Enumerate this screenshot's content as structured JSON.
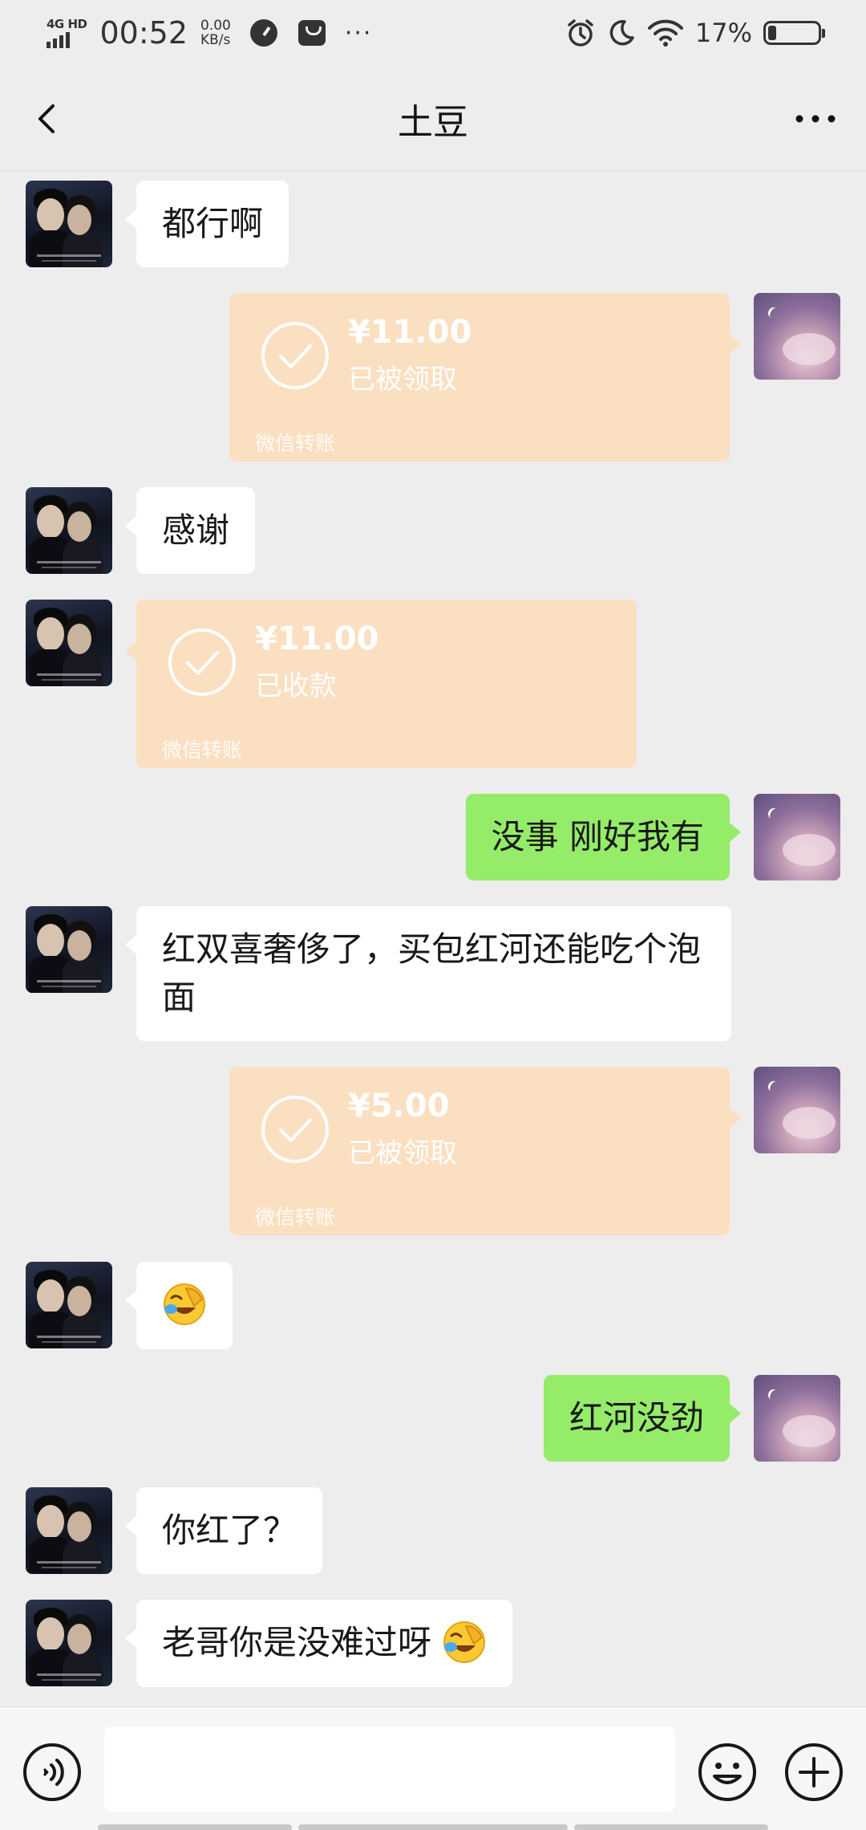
{
  "status_bar": {
    "network": "4G HD",
    "time": "00:52",
    "speed_value": "0.00",
    "speed_unit": "KB/s",
    "overflow": "···",
    "battery_percent": "17%"
  },
  "header": {
    "title": "土豆",
    "back_icon": "chevron-left-icon",
    "more_icon": "more-dots-icon"
  },
  "messages": [
    {
      "sender": "other",
      "type": "text",
      "text": "都行啊"
    },
    {
      "sender": "me",
      "type": "transfer",
      "amount": "¥11.00",
      "status": "已被领取",
      "label": "微信转账"
    },
    {
      "sender": "other",
      "type": "text",
      "text": "感谢"
    },
    {
      "sender": "other",
      "type": "transfer",
      "amount": "¥11.00",
      "status": "已收款",
      "label": "微信转账"
    },
    {
      "sender": "me",
      "type": "text",
      "text": "没事 刚好我有"
    },
    {
      "sender": "other",
      "type": "text",
      "text": "红双喜奢侈了，买包红河还能吃个泡面"
    },
    {
      "sender": "me",
      "type": "transfer",
      "amount": "¥5.00",
      "status": "已被领取",
      "label": "微信转账"
    },
    {
      "sender": "other",
      "type": "emoji",
      "emoji": "facepalm-laughing-emoji"
    },
    {
      "sender": "me",
      "type": "text",
      "text": "红河没劲"
    },
    {
      "sender": "other",
      "type": "text",
      "text": "你红了？"
    },
    {
      "sender": "other",
      "type": "text",
      "text": "老哥你是没难过呀",
      "emoji": "facepalm-laughing-emoji"
    }
  ],
  "input_bar": {
    "voice_icon": "voice-icon",
    "message_value": "",
    "emoji_icon": "emoji-icon",
    "more_icon": "plus-icon"
  },
  "colors": {
    "background": "#ededed",
    "outgoing_bubble": "#95ec69",
    "incoming_bubble": "#ffffff",
    "transfer_card": "#fbdfc1"
  }
}
